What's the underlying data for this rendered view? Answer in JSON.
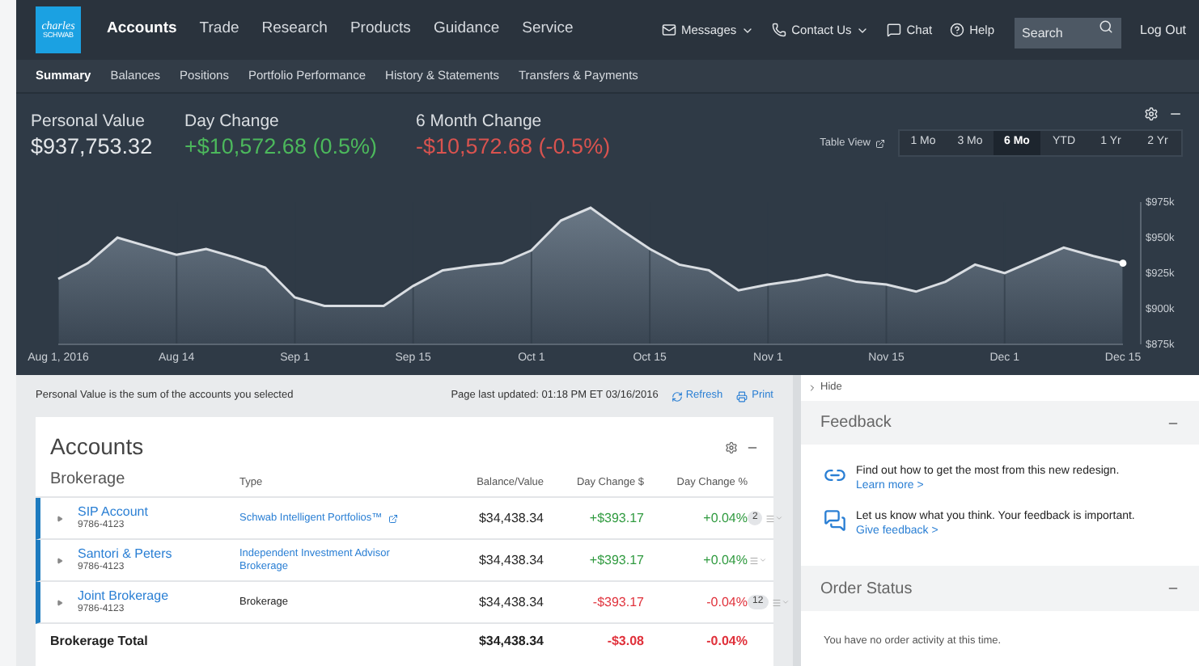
{
  "nav": {
    "logo": {
      "line1": "charles",
      "line2": "SCHWAB"
    },
    "items": [
      {
        "label": "Accounts",
        "selected": true
      },
      {
        "label": "Trade",
        "selected": false
      },
      {
        "label": "Research",
        "selected": false
      },
      {
        "label": "Products",
        "selected": false
      },
      {
        "label": "Guidance",
        "selected": false
      },
      {
        "label": "Service",
        "selected": false
      }
    ],
    "utilities": [
      {
        "label": "Messages",
        "kind": "messages",
        "dropdown": true
      },
      {
        "label": "Contact Us",
        "kind": "contact",
        "dropdown": true
      },
      {
        "label": "Chat",
        "kind": "chat",
        "dropdown": false
      },
      {
        "label": "Help",
        "kind": "help",
        "dropdown": false
      }
    ],
    "search": {
      "placeholder": "Search"
    },
    "logout": "Log Out"
  },
  "subnav": [
    {
      "label": "Summary",
      "selected": true
    },
    {
      "label": "Balances",
      "selected": false
    },
    {
      "label": "Positions",
      "selected": false
    },
    {
      "label": "Portfolio Performance",
      "selected": false
    },
    {
      "label": "History & Statements",
      "selected": false
    },
    {
      "label": "Transfers & Payments",
      "selected": false
    }
  ],
  "summary": {
    "metrics": [
      {
        "label": "Personal Value",
        "value": "$937,753.32",
        "color": "#e4e7ea"
      },
      {
        "label": "Day Change",
        "value": "+$10,572.68 (0.5%)",
        "color": "#4cb85c"
      },
      {
        "label": "6 Month Change",
        "value": "-$10,572.68 (-0.5%)",
        "color": "#d9534f"
      }
    ],
    "table_view": "Table View",
    "ranges": [
      {
        "label": "1 Mo",
        "selected": false
      },
      {
        "label": "3 Mo",
        "selected": false
      },
      {
        "label": "6 Mo",
        "selected": true
      },
      {
        "label": "YTD",
        "selected": false
      },
      {
        "label": "1 Yr",
        "selected": false
      },
      {
        "label": "2 Yr",
        "selected": false
      }
    ],
    "chart_data": {
      "type": "area",
      "grid": true,
      "categories": [
        "Aug 1, 2016",
        null,
        null,
        null,
        "Aug 14",
        null,
        null,
        null,
        "Sep 1",
        null,
        null,
        null,
        "Sep 15",
        null,
        null,
        null,
        "Oct 1",
        null,
        null,
        null,
        "Oct 15",
        null,
        null,
        null,
        "Nov 1",
        null,
        null,
        null,
        "Nov 15",
        null,
        null,
        null,
        "Dec 1",
        null,
        null,
        null,
        "Dec 15"
      ],
      "series": [
        {
          "color": "#d9dde2",
          "values": [
            921,
            932,
            950,
            944,
            938,
            942,
            936,
            929,
            908,
            902,
            902,
            902,
            916,
            927,
            930,
            932,
            941,
            962,
            971,
            956,
            942,
            931,
            927,
            913,
            917,
            920,
            924,
            919,
            917,
            912,
            919,
            931,
            925,
            934,
            943,
            937,
            932
          ]
        }
      ],
      "yticks": [
        {
          "value": 875,
          "label": "$875k"
        },
        {
          "value": 900,
          "label": "$900k"
        },
        {
          "value": 925,
          "label": "$925k"
        },
        {
          "value": 950,
          "label": "$950k"
        },
        {
          "value": 975,
          "label": "$975k"
        }
      ],
      "ylim": [
        875,
        975
      ]
    }
  },
  "info": {
    "note": "Personal Value is the sum of the accounts you selected",
    "updated": "Page last updated: 01:18 PM ET 03/16/2016",
    "refresh": "Refresh",
    "print": "Print"
  },
  "accounts": {
    "title": "Accounts",
    "group": "Brokerage",
    "columns": [
      "Type",
      "Balance/Value",
      "Day Change $",
      "Day Change %"
    ],
    "rows": [
      {
        "name": "SIP Account",
        "number": "9786-4123",
        "type": "Schwab Intelligent Portfolios™",
        "type_link": true,
        "external": true,
        "balance": "$34,438.34",
        "day_change": "+$393.17",
        "day_change_pct": "+0.04%",
        "color": "#2f9a3f",
        "badge": "2"
      },
      {
        "name": "Santori & Peters",
        "number": "9786-4123",
        "type": "Independent Investment Advisor Brokerage",
        "type_link": true,
        "external": false,
        "balance": "$34,438.34",
        "day_change": "+$393.17",
        "day_change_pct": "+0.04%",
        "color": "#2f9a3f"
      },
      {
        "name": "Joint Brokerage",
        "number": "9786-4123",
        "type": "Brokerage",
        "type_link": false,
        "external": false,
        "balance": "$34,438.34",
        "day_change": "-$393.17",
        "day_change_pct": "-0.04%",
        "color": "#e0313b",
        "badge": "12"
      }
    ],
    "total": {
      "label": "Brokerage Total",
      "balance": "$34,438.34",
      "day_change": "-$3.08",
      "day_change_pct": "-0.04%",
      "color": "#e0313b"
    }
  },
  "sidebar": {
    "hide": "Hide",
    "feedback": {
      "title": "Feedback",
      "items": [
        {
          "kind": "tour",
          "text": "Find out how to get the most from this new redesign.",
          "link": "Learn more >"
        },
        {
          "kind": "chat",
          "text": "Let us know what you think. Your feedback is important.",
          "link": "Give feedback >"
        }
      ]
    },
    "order_status": {
      "title": "Order Status",
      "message": "You have no order activity at this time."
    }
  }
}
